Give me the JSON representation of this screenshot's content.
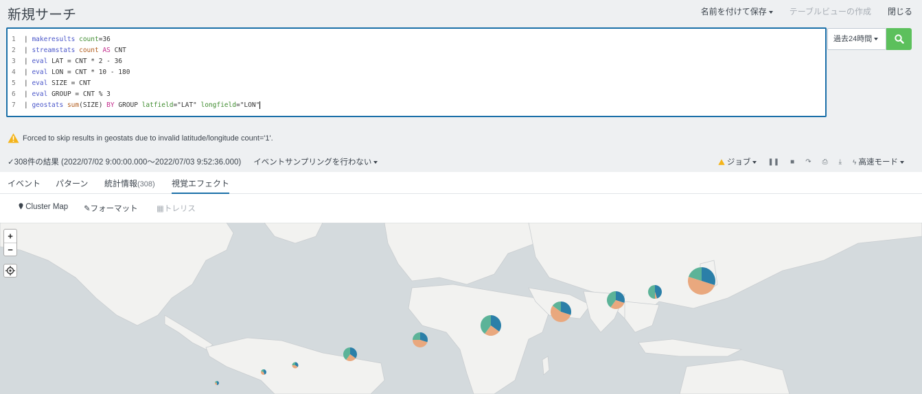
{
  "page": {
    "title": "新規サーチ"
  },
  "top_actions": {
    "save_as": "名前を付けて保存",
    "table_view": "テーブルビューの作成",
    "close": "閉じる"
  },
  "search": {
    "lines": [
      {
        "no": "1",
        "tokens": [
          [
            "kw-plain",
            "| "
          ],
          [
            "kw-cmd",
            "makeresults"
          ],
          [
            "kw-plain",
            " "
          ],
          [
            "kw-arg",
            "count"
          ],
          [
            "kw-plain",
            "=36"
          ]
        ]
      },
      {
        "no": "2",
        "tokens": [
          [
            "kw-plain",
            "| "
          ],
          [
            "kw-cmd",
            "streamstats"
          ],
          [
            "kw-plain",
            " "
          ],
          [
            "kw-fn",
            "count"
          ],
          [
            "kw-plain",
            " "
          ],
          [
            "kw-op",
            "AS"
          ],
          [
            "kw-plain",
            " CNT"
          ]
        ]
      },
      {
        "no": "3",
        "tokens": [
          [
            "kw-plain",
            "| "
          ],
          [
            "kw-cmd",
            "eval"
          ],
          [
            "kw-plain",
            " LAT = CNT * 2 - 36"
          ]
        ]
      },
      {
        "no": "4",
        "tokens": [
          [
            "kw-plain",
            "| "
          ],
          [
            "kw-cmd",
            "eval"
          ],
          [
            "kw-plain",
            " LON = CNT * 10 - 180"
          ]
        ]
      },
      {
        "no": "5",
        "tokens": [
          [
            "kw-plain",
            "| "
          ],
          [
            "kw-cmd",
            "eval"
          ],
          [
            "kw-plain",
            " SIZE = CNT"
          ]
        ]
      },
      {
        "no": "6",
        "tokens": [
          [
            "kw-plain",
            "| "
          ],
          [
            "kw-cmd",
            "eval"
          ],
          [
            "kw-plain",
            " GROUP = CNT % 3"
          ]
        ]
      },
      {
        "no": "7",
        "tokens": [
          [
            "kw-plain",
            "| "
          ],
          [
            "kw-cmd",
            "geostats"
          ],
          [
            "kw-plain",
            " "
          ],
          [
            "kw-fn",
            "sum"
          ],
          [
            "kw-plain",
            "(SIZE) "
          ],
          [
            "kw-op",
            "BY"
          ],
          [
            "kw-plain",
            " GROUP "
          ],
          [
            "kw-arg",
            "latfield"
          ],
          [
            "kw-plain",
            "=\"LAT\" "
          ],
          [
            "kw-arg",
            "longfield"
          ],
          [
            "kw-plain",
            "=\"LON\""
          ]
        ]
      }
    ],
    "time_range": "過去24時間",
    "button_icon": "search-icon"
  },
  "warning": {
    "text": "Forced to skip results in geostats due to invalid latitude/longitude count='1'.",
    "icon": "warning-icon"
  },
  "results": {
    "summary": "308件の結果 (2022/07/02 9:00:00.000～2022/07/03 9:52:36.000)",
    "sampling": "イベントサンプリングを行わない",
    "job": "ジョブ",
    "mode": "高速モード"
  },
  "tabs": [
    {
      "label": "イベント",
      "count": ""
    },
    {
      "label": "パターン",
      "count": ""
    },
    {
      "label": "統計情報",
      "count": "(308)"
    },
    {
      "label": "視覚エフェクト",
      "count": ""
    }
  ],
  "subtoolbar": {
    "cluster_map": "Cluster Map",
    "format": "フォーマット",
    "trellis": "トレリス"
  },
  "colors": {
    "group_0": "#2b7fa8",
    "group_1": "#e9a87e",
    "group_2": "#5cb398",
    "accent": "#1a6fa8",
    "search_btn": "#5cc05c"
  }
}
